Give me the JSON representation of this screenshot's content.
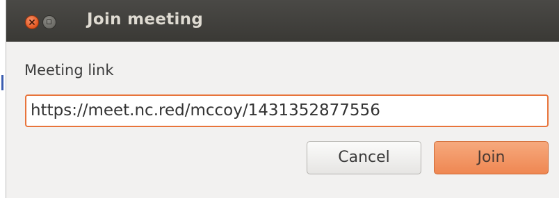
{
  "window": {
    "title": "Join meeting",
    "controls": {
      "close_icon": "close-icon",
      "maximize_icon": "maximize-icon"
    }
  },
  "form": {
    "label": "Meeting link",
    "link_value": "https://meet.nc.red/mccoy/1431352877556"
  },
  "buttons": {
    "cancel_label": "Cancel",
    "join_label": "Join"
  },
  "colors": {
    "accent": "#e8743b",
    "titlebar": "#3c3b37",
    "close_button": "#e2561f",
    "join_button": "#ef8752"
  }
}
